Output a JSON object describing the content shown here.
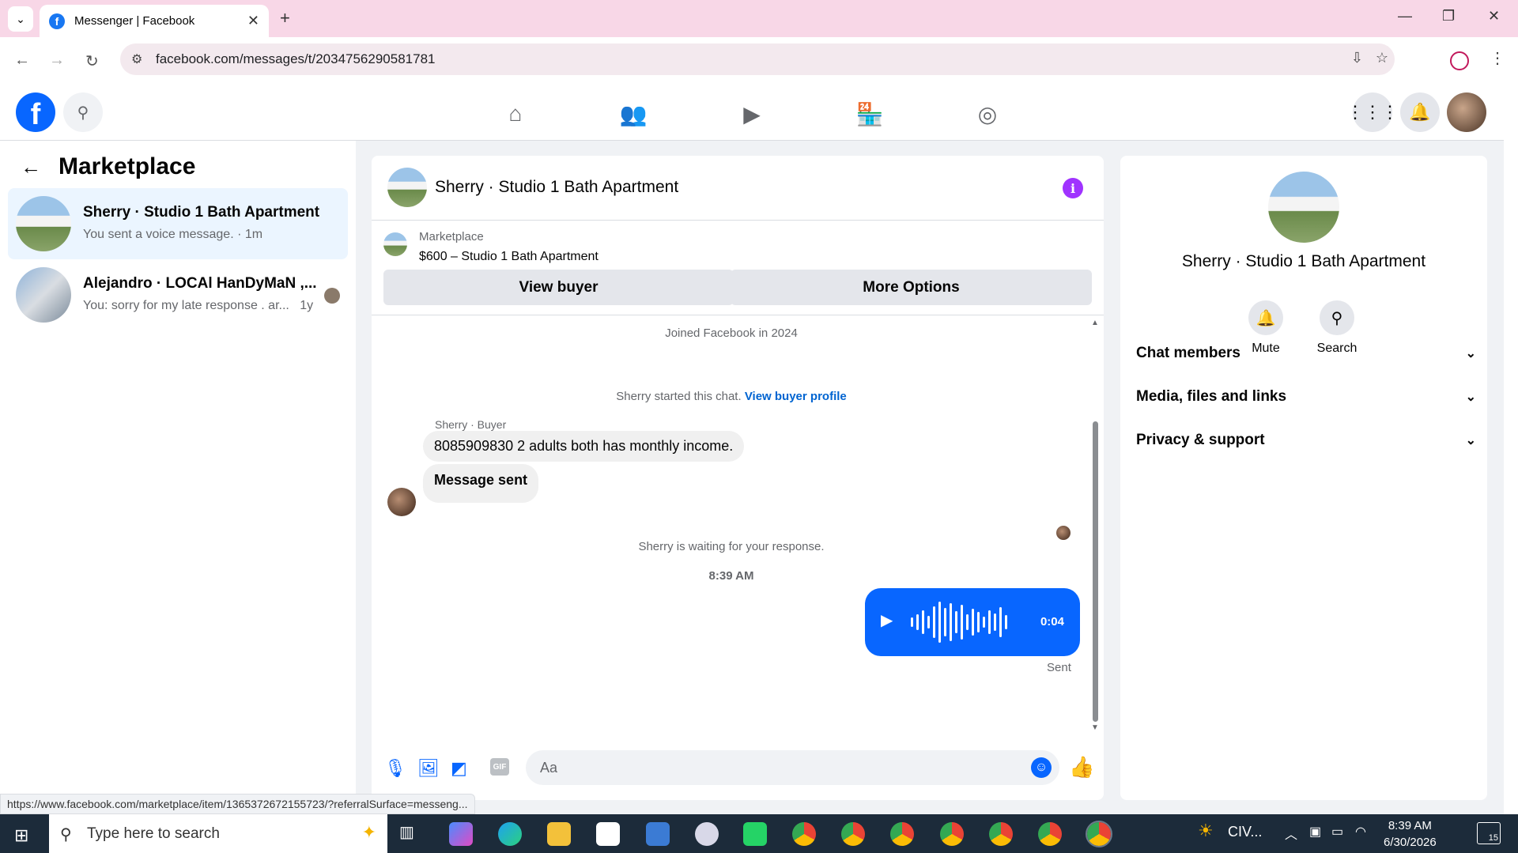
{
  "browser": {
    "tab_title": "Messenger | Facebook",
    "url": "facebook.com/messages/t/2034756290581781",
    "status_url": "https://www.facebook.com/marketplace/item/1365372672155723/?referralSurface=messeng..."
  },
  "left": {
    "title": "Marketplace",
    "conversations": [
      {
        "name": "Sherry · Studio 1 Bath Apartment",
        "preview": "You sent a voice message. · 1m"
      },
      {
        "name": "Alejandro · LOCAl HanDyMaN ,...",
        "preview": "You: sorry for my late response . ar...",
        "time": "1y"
      }
    ]
  },
  "chat": {
    "title": "Sherry · Studio 1 Bath Apartment",
    "listing_category": "Marketplace",
    "listing_price": "$600 – Studio 1 Bath Apartment",
    "view_buyer": "View buyer",
    "more_options": "More Options",
    "joined": "Joined Facebook in 2024",
    "started_text": "Sherry started this chat.",
    "started_link": "View buyer profile",
    "sender": "Sherry · Buyer",
    "msg1": "8085909830 2 adults both has monthly income.",
    "msg2": "Message sent",
    "waiting": "Sherry is waiting for your response.",
    "timestamp": "8:39 AM",
    "voice_duration": "0:04",
    "sent_status": "Sent",
    "input_placeholder": "Aa",
    "gif": "GIF"
  },
  "right": {
    "name": "Sherry · Studio 1 Bath Apartment",
    "mute": "Mute",
    "search": "Search",
    "sections": [
      "Chat members",
      "Media, files and links",
      "Privacy & support"
    ]
  },
  "taskbar": {
    "search_placeholder": "Type here to search",
    "weather": "CIV...",
    "time": "8:39 AM",
    "date": "6/30/2026",
    "notifications": "15"
  },
  "colors": {
    "accent": "#0866ff",
    "info": "#a033ff",
    "tab_strip": "#f8d7e7"
  }
}
